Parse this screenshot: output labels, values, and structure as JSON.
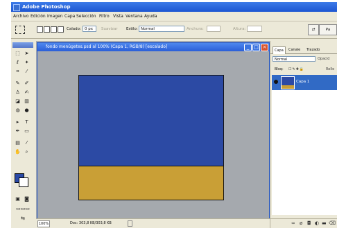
{
  "window": {
    "title": "Adobe Photoshop"
  },
  "menu": [
    "Archivo",
    "Edición",
    "Imagen",
    "Capa",
    "Selección",
    "Filtro",
    "Vista",
    "Ventana",
    "Ayuda"
  ],
  "options": {
    "feather_label": "Calado:",
    "feather_value": "0 px",
    "antialias_label": "Suavizar",
    "style_label": "Estilo:",
    "style_value": "Normal",
    "width_label": "Anchura:",
    "height_label": "Altura:",
    "palette_button": "Pa"
  },
  "document": {
    "title": "fondo menúgetes.psd al 100% (Capa 1, RGB/8) [escalado]",
    "colors": {
      "top": "#2c4aa4",
      "bottom": "#c99f36"
    }
  },
  "status": {
    "zoom": "100%",
    "doc": "Doc: 303,8 KB/303,8 KB"
  },
  "panel": {
    "tabs": [
      "Capa",
      "Canale",
      "Trazado"
    ],
    "blend_mode": "Normal",
    "opacity_label": "Opacid",
    "lock_label": "Bloq:",
    "fill_label": "Relle",
    "layers": [
      {
        "name": "Capa 1"
      }
    ]
  },
  "colors": {
    "accent": "#2558c8",
    "foreground": "#2a4aa6",
    "background": "#ffffff"
  }
}
